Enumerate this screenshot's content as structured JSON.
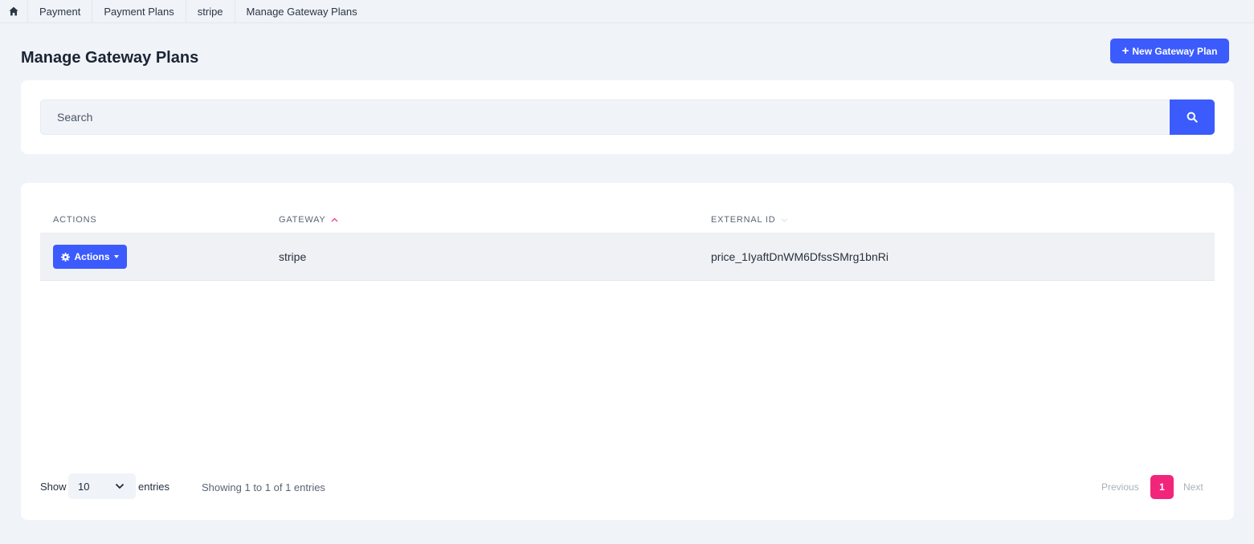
{
  "breadcrumb": {
    "home_icon": "home-icon",
    "items": [
      "Payment",
      "Payment Plans",
      "stripe",
      "Manage Gateway Plans"
    ]
  },
  "header": {
    "title": "Manage Gateway Plans",
    "new_button_label": "New Gateway Plan"
  },
  "search": {
    "placeholder": "Search",
    "value": ""
  },
  "table": {
    "columns": [
      "ACTIONS",
      "GATEWAY",
      "EXTERNAL ID"
    ],
    "sort_column": "GATEWAY",
    "sort_direction": "asc",
    "rows": [
      {
        "actions_label": "Actions",
        "gateway": "stripe",
        "external_id": "price_1IyaftDnWM6DfssSMrg1bnRi"
      }
    ]
  },
  "footer": {
    "show_label": "Show",
    "entries_label": "entries",
    "page_length": "10",
    "info": "Showing 1 to 1 of 1 entries",
    "prev_label": "Previous",
    "current_page": "1",
    "next_label": "Next"
  },
  "colors": {
    "primary": "#3b5bfd",
    "accent": "#f1267a",
    "background": "#f0f3f7"
  }
}
